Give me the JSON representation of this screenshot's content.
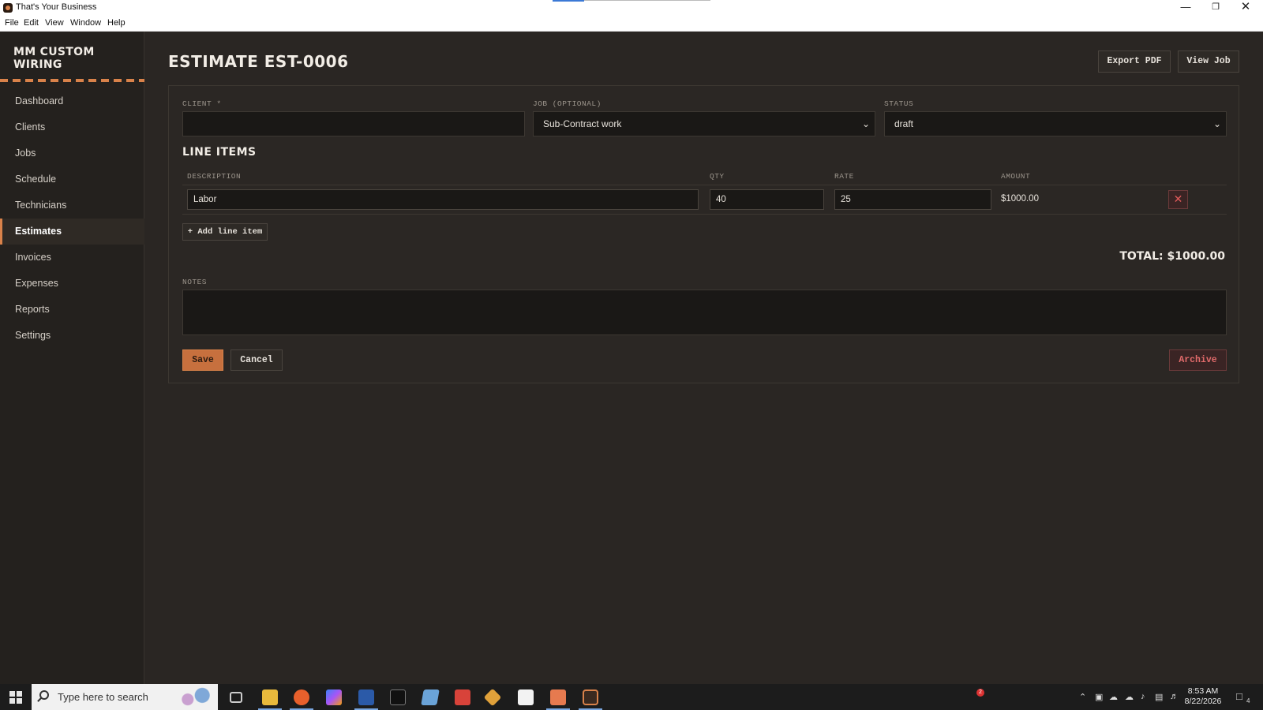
{
  "window": {
    "title": "That's Your Business",
    "controls": {
      "minimize": "—",
      "maximize": "❐",
      "close": "✕"
    }
  },
  "menu": [
    "File",
    "Edit",
    "View",
    "Window",
    "Help"
  ],
  "sidebar": {
    "brand": "MM CUSTOM WIRING",
    "items": [
      {
        "label": "Dashboard"
      },
      {
        "label": "Clients"
      },
      {
        "label": "Jobs"
      },
      {
        "label": "Schedule"
      },
      {
        "label": "Technicians"
      },
      {
        "label": "Estimates",
        "active": true
      },
      {
        "label": "Invoices"
      },
      {
        "label": "Expenses"
      },
      {
        "label": "Reports"
      },
      {
        "label": "Settings"
      }
    ]
  },
  "header": {
    "title": "ESTIMATE EST-0006",
    "export_pdf": "Export PDF",
    "view_job": "View Job"
  },
  "form": {
    "client_label": "CLIENT *",
    "client_value": "",
    "job_label": "JOB (OPTIONAL)",
    "job_value": "Sub-Contract work",
    "status_label": "STATUS",
    "status_value": "draft",
    "line_items_title": "LINE ITEMS",
    "columns": {
      "description": "DESCRIPTION",
      "qty": "QTY",
      "rate": "RATE",
      "amount": "AMOUNT"
    },
    "line_items": [
      {
        "description": "Labor",
        "qty": "40",
        "rate": "25",
        "amount": "$1000.00",
        "delete": "✕"
      }
    ],
    "add_line_item": "+ Add line item",
    "total": "TOTAL: $1000.00",
    "notes_label": "NOTES",
    "notes_value": "",
    "save": "Save",
    "cancel": "Cancel",
    "archive": "Archive"
  },
  "taskbar": {
    "search_placeholder": "Type here to search",
    "notification_count": "2",
    "time": "8:53 AM",
    "date": "8/22/2026",
    "action_center_count": "4"
  },
  "colors": {
    "accent": "#d9824a",
    "background": "#2a2623",
    "sidebar": "#24211e",
    "danger": "#e25b5b"
  }
}
